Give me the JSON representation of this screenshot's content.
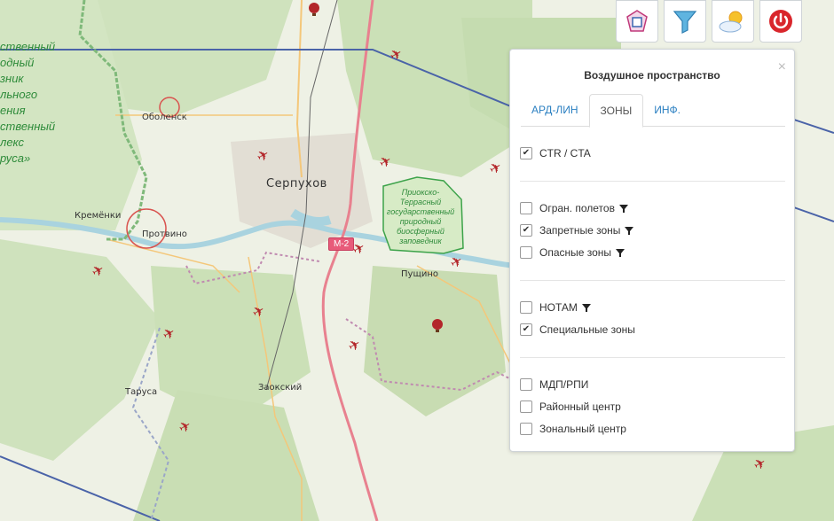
{
  "map": {
    "left_text": [
      "ственный",
      "одный",
      "зник",
      "льного",
      "ения",
      "ственный",
      "лекс",
      "руса»"
    ],
    "places": {
      "obolensk": "Оболенск",
      "serpukhov": "Серпухов",
      "kremenki": "Кремёнки",
      "protvino": "Протвино",
      "pushchino": "Пущино",
      "tarusa": "Таруса",
      "zaokskiy": "Заокский"
    },
    "road_shield": "М-2",
    "reserve_lines": [
      "Приокско-",
      "Террасный",
      "государственный",
      "природный",
      "биосферный",
      "заповедник"
    ]
  },
  "toolbar": {
    "buttons": [
      {
        "icon": "airspace-zones-icon"
      },
      {
        "icon": "filter-icon"
      },
      {
        "icon": "weather-icon"
      },
      {
        "icon": "power-icon"
      }
    ]
  },
  "panel": {
    "title": "Воздушное пространство",
    "close": "×",
    "tabs": [
      "АРД-ЛИН",
      "ЗОНЫ",
      "ИНФ."
    ],
    "active_tab": "ЗОНЫ",
    "groups": [
      [
        {
          "label": "CTR / CTA",
          "checked": true,
          "filter": false
        }
      ],
      [
        {
          "label": "Огран. полетов",
          "checked": false,
          "filter": true
        },
        {
          "label": "Запретные зоны",
          "checked": true,
          "filter": true
        },
        {
          "label": "Опасные зоны",
          "checked": false,
          "filter": true
        }
      ],
      [
        {
          "label": "НОТАМ",
          "checked": false,
          "filter": true
        },
        {
          "label": "Специальные зоны",
          "checked": true,
          "filter": false
        }
      ],
      [
        {
          "label": "МДП/РПИ",
          "checked": false,
          "filter": false
        },
        {
          "label": "Районный центр",
          "checked": false,
          "filter": false
        },
        {
          "label": "Зональный центр",
          "checked": false,
          "filter": false
        }
      ]
    ]
  },
  "colors": {
    "water": "#a9d3df",
    "forest": "#c9dfb6",
    "road_major": "#e8818f",
    "road_minor": "#f4c77a",
    "boundary_blue": "#4a63a8",
    "reserve": "#3da34a"
  }
}
